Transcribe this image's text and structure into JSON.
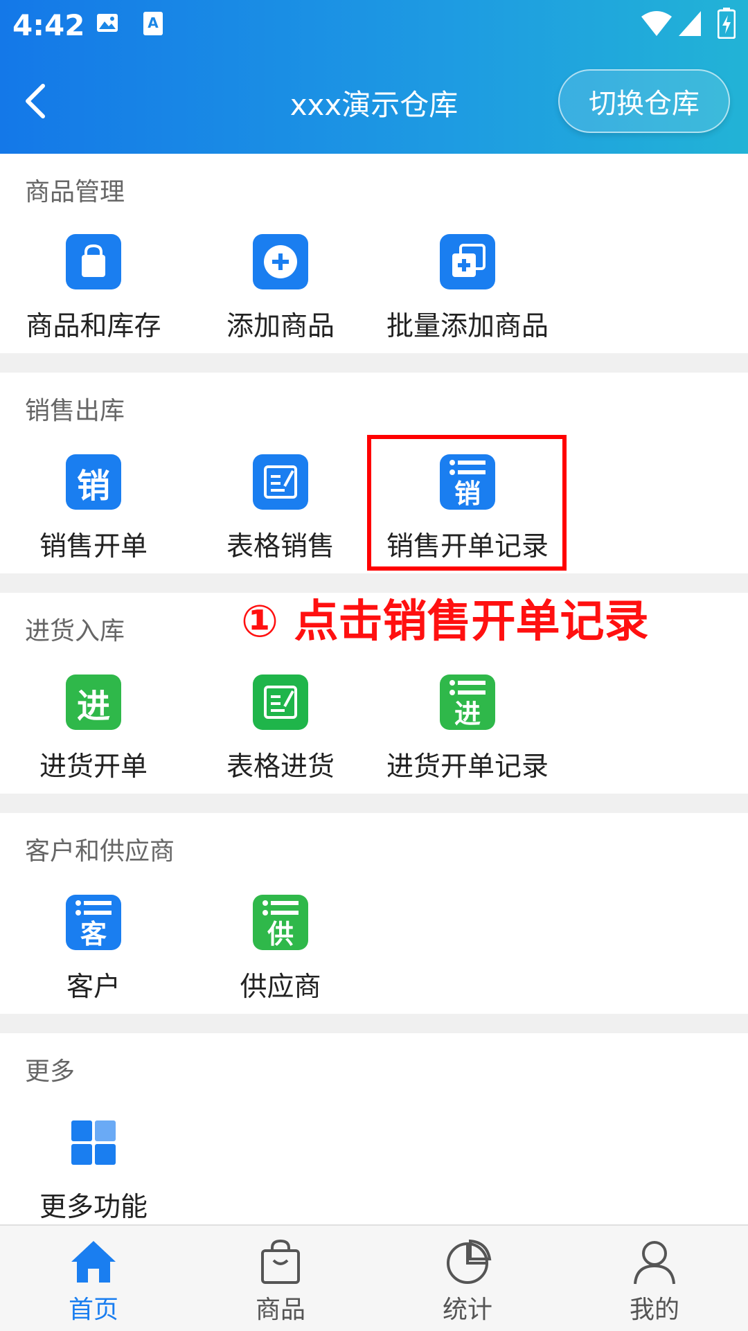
{
  "status_bar": {
    "time": "4:42"
  },
  "header": {
    "title": "xxx演示仓库",
    "switch_label": "切换仓库"
  },
  "sections": [
    {
      "title": "商品管理",
      "items": [
        {
          "label": "商品和库存",
          "icon": "shopping-bag-icon",
          "color": "#1a7ef0"
        },
        {
          "label": "添加商品",
          "icon": "add-circle-icon",
          "color": "#1a7ef0"
        },
        {
          "label": "批量添加商品",
          "icon": "batch-add-icon",
          "color": "#1a7ef0"
        }
      ]
    },
    {
      "title": "销售出库",
      "items": [
        {
          "label": "销售开单",
          "icon": "sales-order-icon",
          "glyph": "销",
          "color": "#1a7ef0"
        },
        {
          "label": "表格销售",
          "icon": "table-edit-icon",
          "color": "#1a7ef0"
        },
        {
          "label": "销售开单记录",
          "icon": "sales-record-icon",
          "glyph": "销",
          "color": "#1a7ef0"
        }
      ]
    },
    {
      "title": "进货入库",
      "items": [
        {
          "label": "进货开单",
          "icon": "purchase-order-icon",
          "glyph": "进",
          "color": "#2fb84a"
        },
        {
          "label": "表格进货",
          "icon": "table-edit-icon",
          "color": "#2fb84a"
        },
        {
          "label": "进货开单记录",
          "icon": "purchase-record-icon",
          "glyph": "进",
          "color": "#2fb84a"
        }
      ]
    },
    {
      "title": "客户和供应商",
      "items": [
        {
          "label": "客户",
          "icon": "customer-list-icon",
          "glyph": "客",
          "color": "#1a7ef0"
        },
        {
          "label": "供应商",
          "icon": "supplier-list-icon",
          "glyph": "供",
          "color": "#2fb84a"
        }
      ]
    },
    {
      "title": "更多",
      "items": [
        {
          "label": "更多功能",
          "icon": "grid-icon",
          "color": "#1a7ef0"
        }
      ]
    }
  ],
  "annotation": {
    "text": "① 点击销售开单记录",
    "color": "#ff1010"
  },
  "bottom_nav": [
    {
      "label": "首页",
      "icon": "home-icon",
      "active": true
    },
    {
      "label": "商品",
      "icon": "shopping-bag-icon",
      "active": false
    },
    {
      "label": "统计",
      "icon": "pie-chart-icon",
      "active": false
    },
    {
      "label": "我的",
      "icon": "user-icon",
      "active": false
    }
  ]
}
